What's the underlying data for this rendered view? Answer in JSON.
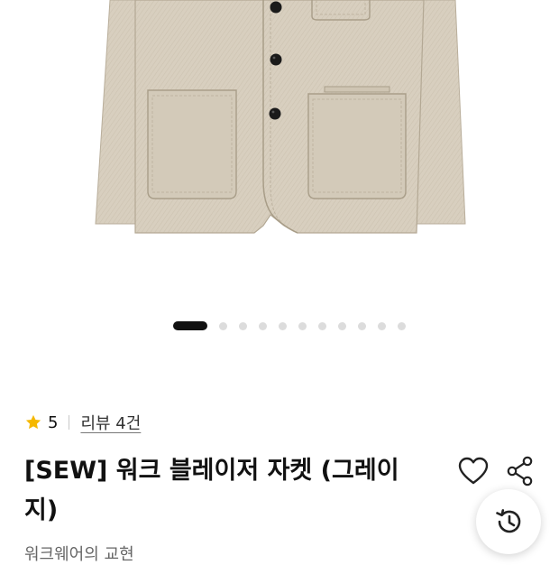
{
  "product": {
    "image_icon": "beige-work-blazer-jacket-photo",
    "colors": {
      "fabric": "#d8cfbf",
      "button": "#1a1a1a"
    }
  },
  "carousel": {
    "active_index": 0,
    "total_slides": 11,
    "active_color": "#111111",
    "inactive_color": "#dcdcdc"
  },
  "rating": {
    "star_icon": "star-icon",
    "star_color": "#f5b800",
    "score": "5",
    "review_label": "리뷰 4건"
  },
  "title": {
    "text": "[SEW] 워크 블레이저 자켓 (그레이지)"
  },
  "actions": {
    "like_icon": "heart-icon",
    "share_icon": "share-icon",
    "history_icon": "history-icon"
  },
  "brand": {
    "text": "워크웨어의 교현"
  }
}
